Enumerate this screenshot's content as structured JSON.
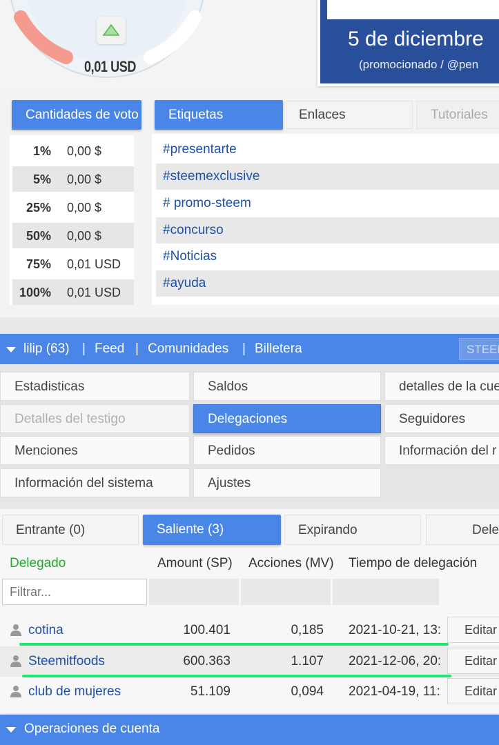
{
  "gauge": {
    "value": "0,01 USD"
  },
  "promo": {
    "title": "5 de diciembre",
    "subtitle": "(promocionado / @pen"
  },
  "vote_panel": {
    "tab_label": "Cantidades de voto",
    "rows": [
      {
        "pct": "1%",
        "value": "0,00 $"
      },
      {
        "pct": "5%",
        "value": "0,00 $"
      },
      {
        "pct": "25%",
        "value": "0,00 $"
      },
      {
        "pct": "50%",
        "value": "0,00 $"
      },
      {
        "pct": "75%",
        "value": "0,01 USD"
      },
      {
        "pct": "100%",
        "value": "0,01 USD"
      }
    ]
  },
  "links_panel": {
    "tabs": [
      "Etiquetas",
      "Enlaces",
      "Tutoriales"
    ],
    "tags": [
      "#presentarte",
      "#steemexclusive",
      "# promo-steem",
      "#concurso",
      "#Noticias",
      "#ayuda"
    ]
  },
  "navbar": {
    "user": "lilip (63)",
    "sep": "|",
    "feed": "Feed",
    "communities": "Comunidades",
    "wallet": "Billetera",
    "steem": "STEEM"
  },
  "menu": {
    "estadisticas": "Estadisticas",
    "saldos": "Saldos",
    "detalles_cuenta": "detalles de la cue",
    "detalles_testigo": "Detalles del testigo",
    "delegaciones": "Delegaciones",
    "seguidores": "Seguidores",
    "menciones": "Menciones",
    "pedidos": "Pedidos",
    "informacion_del": "Información del r",
    "informacion_sistema": "Información del sistema",
    "ajustes": "Ajustes"
  },
  "delegation_tabs": {
    "entrante": "Entrante (0)",
    "saliente": "Saliente (3)",
    "expirando": "Expirando",
    "dele": "Dele"
  },
  "table": {
    "headers": {
      "delegado": "Delegado",
      "amount": "Amount (SP)",
      "acciones": "Acciones (MV)",
      "tiempo": "Tiempo de delegación"
    },
    "filter_placeholder": "Filtrar...",
    "rows": [
      {
        "user": "cotina",
        "amount": "100.401",
        "mv": "0,185",
        "time": "2021-10-21, 13:",
        "edit": "Editar"
      },
      {
        "user": "Steemitfoods",
        "amount": "600.363",
        "mv": "1.107",
        "time": "2021-12-06, 20:",
        "edit": "Editar"
      },
      {
        "user": "club de mujeres",
        "amount": "51.109",
        "mv": "0,094",
        "time": "2021-04-19, 11:",
        "edit": "Editar"
      }
    ]
  },
  "ops": {
    "label": "Operaciones de cuenta"
  },
  "colors": {
    "accent": "#4a86e8",
    "link": "#1f4fa6",
    "highlight": "#1de870",
    "header_green": "#22a82e"
  }
}
